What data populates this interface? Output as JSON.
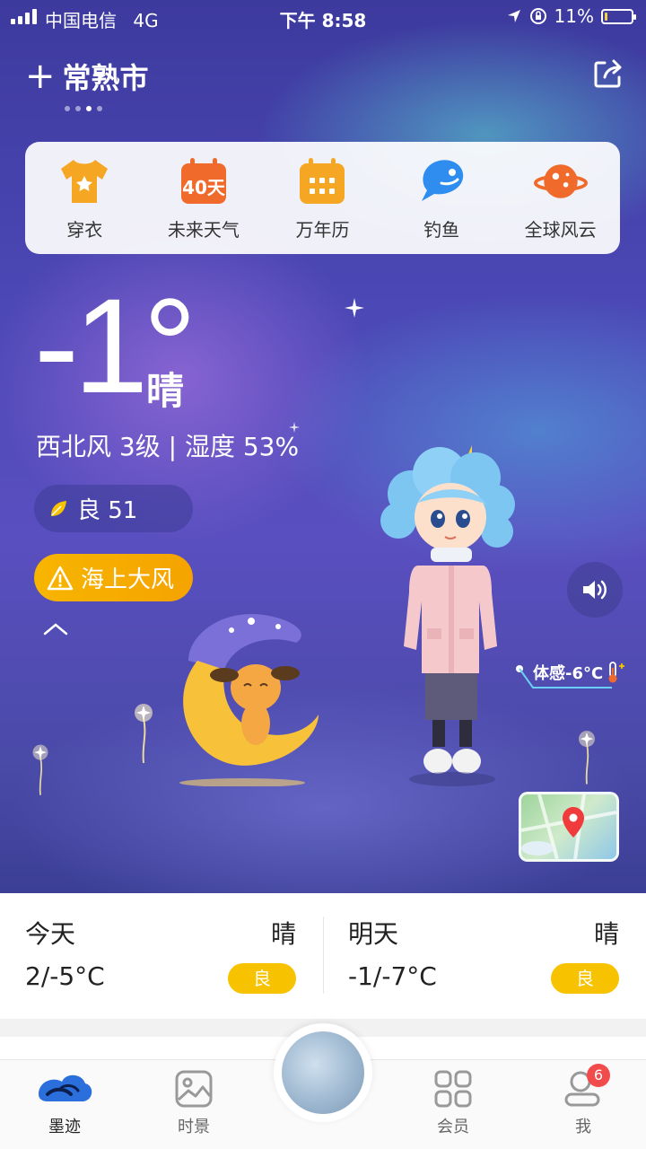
{
  "status_bar": {
    "carrier": "中国电信",
    "network": "4G",
    "time": "下午 8:58",
    "battery": "11%",
    "battery_level": 0.11
  },
  "header": {
    "city": "常熟市",
    "page_count": 4,
    "active_page": 3
  },
  "tools": [
    {
      "label": "穿衣",
      "icon": "tshirt-icon",
      "color": "#f5a623"
    },
    {
      "label": "未来天气",
      "icon": "calendar-40-icon",
      "icon_text": "40天",
      "color": "#f06a2b"
    },
    {
      "label": "万年历",
      "icon": "calendar-grid-icon",
      "color": "#f5a623"
    },
    {
      "label": "钓鱼",
      "icon": "fish-icon",
      "color": "#2f8df0"
    },
    {
      "label": "全球风云",
      "icon": "planet-icon",
      "color": "#f06a2b"
    }
  ],
  "current": {
    "temperature": "-1°",
    "condition": "晴",
    "wind_humidity": "西北风 3级 | 湿度 53%",
    "aqi": "良 51",
    "warning": "海上大风",
    "feels_like": "体感-6°C"
  },
  "forecast": [
    {
      "day": "今天",
      "condition": "晴",
      "range": "2/-5°C",
      "aqi": "良"
    },
    {
      "day": "明天",
      "condition": "晴",
      "range": "-1/-7°C",
      "aqi": "良"
    }
  ],
  "nav": {
    "items": [
      {
        "label": "墨迹",
        "icon": "moji-logo-icon"
      },
      {
        "label": "时景",
        "icon": "photo-icon"
      },
      {
        "label": "会员",
        "icon": "grid-icon"
      },
      {
        "label": "我",
        "icon": "profile-icon",
        "badge": "6"
      }
    ]
  },
  "colors": {
    "accent_yellow": "#f7c300",
    "warning_orange": "#f5a300",
    "sky_top": "#3d3a9e",
    "sky_bottom": "#3c3f95"
  }
}
